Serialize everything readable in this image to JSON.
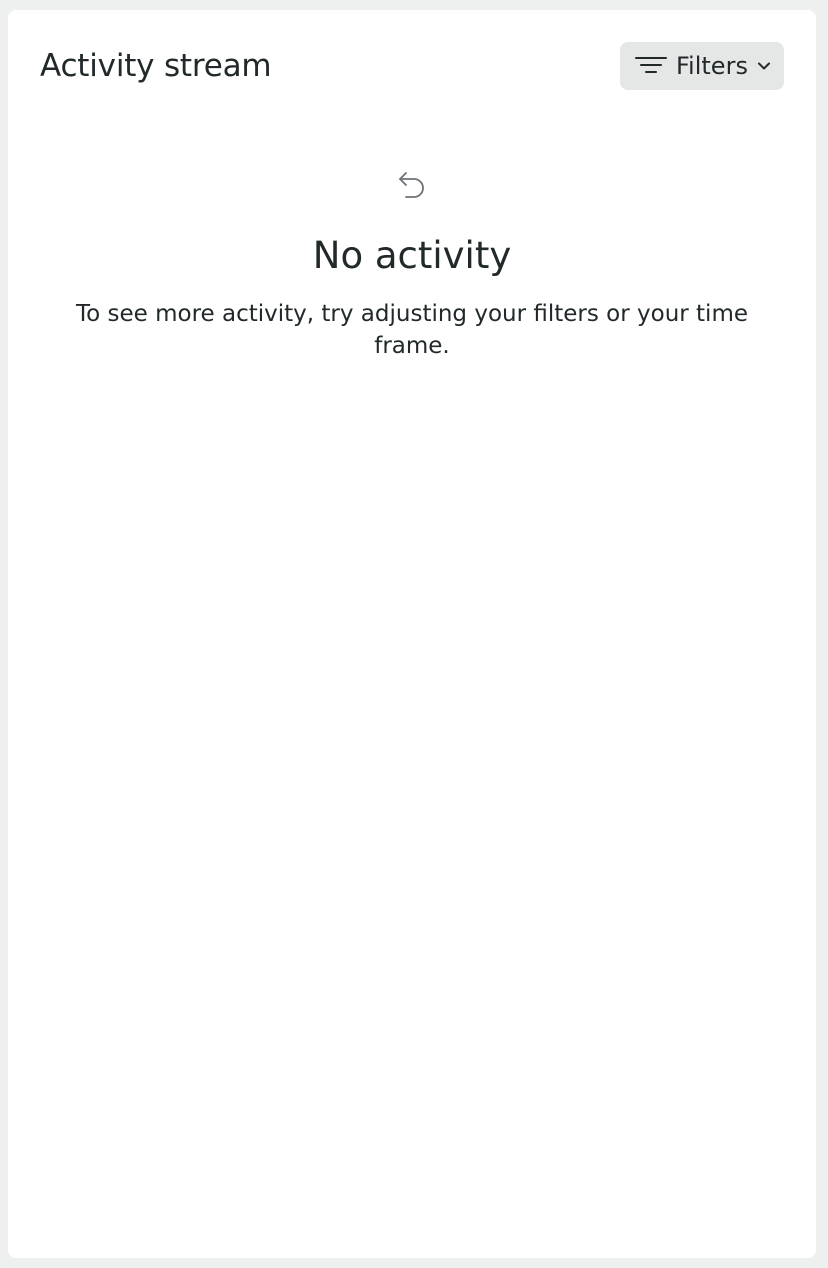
{
  "header": {
    "title": "Activity stream",
    "filters_button": {
      "label": "Filters",
      "icon": "filter-lines-icon",
      "dropdown_icon": "chevron-down-icon"
    }
  },
  "empty_state": {
    "icon": "undo-arrow-icon",
    "title": "No activity",
    "message": "To see more activity, try adjusting your filters or your time frame."
  },
  "colors": {
    "page_background": "#eef0f0",
    "panel_background": "#ffffff",
    "button_background": "#e5e7e7",
    "text": "#21292b",
    "icon_muted": "#6b7375"
  }
}
